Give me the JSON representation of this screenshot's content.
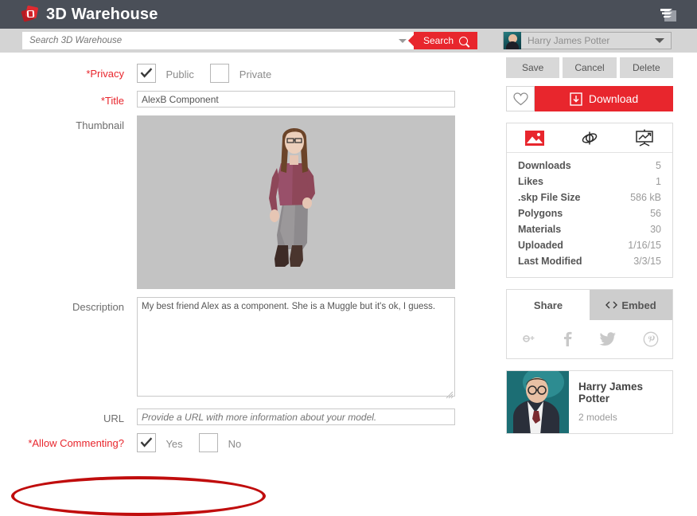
{
  "header": {
    "brand": "3D Warehouse",
    "logo_icon": "warehouse-cubes-logo",
    "sketchup_icon": "sketchup-app-icon"
  },
  "search": {
    "placeholder": "Search 3D Warehouse",
    "value": "",
    "button_label": "Search",
    "button_icon": "magnifier-icon",
    "dropdown_icon": "chevron-down-icon"
  },
  "user": {
    "name": "Harry James Potter",
    "avatar_icon": "user-avatar",
    "caret_icon": "chevron-down-icon"
  },
  "form": {
    "privacy": {
      "label": "*Privacy",
      "options": [
        {
          "label": "Public",
          "checked": true
        },
        {
          "label": "Private",
          "checked": false
        }
      ]
    },
    "title": {
      "label": "*Title",
      "value": "AlexB Component"
    },
    "thumbnail": {
      "label": "Thumbnail",
      "alt": "woman-figure-cutout"
    },
    "description": {
      "label": "Description",
      "value": "My best friend Alex as a component. She is a Muggle but it's ok, I guess."
    },
    "url": {
      "label": "URL",
      "value": "",
      "placeholder": "Provide a URL with more information about your model."
    },
    "commenting": {
      "label": "*Allow Commenting?",
      "options": [
        {
          "label": "Yes",
          "checked": true
        },
        {
          "label": "No",
          "checked": false
        }
      ]
    }
  },
  "actions": {
    "save": "Save",
    "cancel": "Cancel",
    "delete": "Delete",
    "like_icon": "heart-icon",
    "download": "Download",
    "download_icon": "download-tray-icon"
  },
  "model_panel": {
    "tabs": [
      {
        "icon": "image-icon",
        "active": true
      },
      {
        "icon": "rotate-3d-icon",
        "active": false
      },
      {
        "icon": "stats-chart-icon",
        "active": false
      }
    ],
    "stats": [
      {
        "key": "Downloads",
        "value": "5"
      },
      {
        "key": "Likes",
        "value": "1"
      },
      {
        "key": ".skp File Size",
        "value": "586 kB"
      },
      {
        "key": "Polygons",
        "value": "56"
      },
      {
        "key": "Materials",
        "value": "30"
      },
      {
        "key": "Uploaded",
        "value": "1/16/15"
      },
      {
        "key": "Last Modified",
        "value": "3/3/15"
      }
    ]
  },
  "share": {
    "tabs": [
      {
        "label": "Share",
        "active": true
      },
      {
        "label": "Embed",
        "active": false,
        "icon": "code-brackets-icon"
      }
    ],
    "socials": [
      {
        "name": "googleplus-icon",
        "glyph": "g+"
      },
      {
        "name": "facebook-icon",
        "glyph": "f"
      },
      {
        "name": "twitter-icon",
        "glyph": "t"
      },
      {
        "name": "pinterest-icon",
        "glyph": "p"
      }
    ]
  },
  "author": {
    "name": "Harry James Potter",
    "models": "2 models",
    "avatar_icon": "author-photo"
  },
  "annotation": {
    "shape": "red-ellipse-highlight",
    "target": "allow-commenting-row"
  },
  "colors": {
    "header_bg": "#4a4f58",
    "accent_red": "#e8262d",
    "annotation_red": "#c00d0d",
    "panel_border": "#dcdcdc",
    "thumb_bg": "#c3c3c3"
  }
}
